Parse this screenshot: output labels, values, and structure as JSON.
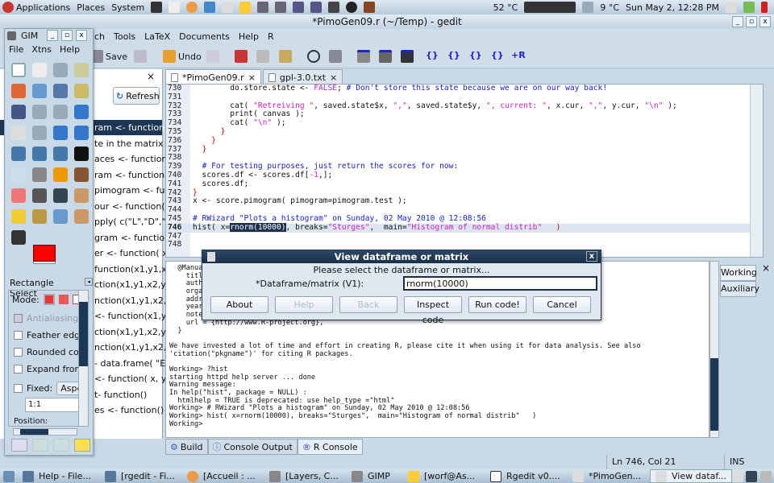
{
  "top_panel": {
    "menus": [
      "Applications",
      "Places",
      "System"
    ],
    "temperature": "52 °C",
    "weather": "9 °C",
    "clock": "Sun May  2, 12:28 PM"
  },
  "window": {
    "title": "*PimoGen09.r (~/Temp) - gedit"
  },
  "menu": [
    "ch",
    "Tools",
    "LaTeX",
    "Documents",
    "Help",
    "R"
  ],
  "toolbar": {
    "save": "Save",
    "undo": "Undo"
  },
  "side_panel": {
    "refresh": "Refresh",
    "items": [
      "ram <- function(",
      "te in the matrix a",
      "aces <- function(",
      "ram <- function(",
      "pimogram <- func",
      "our <- function( x",
      "pply( c(\"L\",\"D\",\"R\",",
      "gram <- function",
      "er <- function( x.p",
      "function(x1,y1,x2",
      "ction(x1,y1,x2,y2)",
      "nction(x1,y1,x2,y",
      "<- function(x1,y1,",
      "ction(x1,y1,x2,y2)",
      "nction(x1,y1,x2,y2",
      "- data.frame( \"Ec",
      "<- function( x, y )",
      "t- function()",
      "es <- function(){"
    ]
  },
  "tabs": [
    {
      "label": "*PimoGen09.r"
    },
    {
      "label": "gpl-3.0.txt"
    }
  ],
  "editor": {
    "lines": [
      {
        "n": "730",
        "html": "        do.store.state <- <span class='kw'>FALSE</span>; <span class='cm'># Don't store this state because we are on our way back!</span>"
      },
      {
        "n": "731",
        "html": ""
      },
      {
        "n": "732",
        "html": "        cat( <span class='str'>\"Retreiving \"</span>, saved.state$x, <span class='str'>\",\"</span>, saved.state$y, <span class='str'>\", current: \"</span>, x.cur, <span class='str'>\",\"</span>, y.cur, <span class='str'>\"\\n\"</span> );"
      },
      {
        "n": "733",
        "html": "        print( canvas );"
      },
      {
        "n": "734",
        "html": "        cat( <span class='str'>\"\\n\"</span> );"
      },
      {
        "n": "735",
        "html": "      <span class='br'>}</span>"
      },
      {
        "n": "736",
        "html": "    <span class='br'>}</span>"
      },
      {
        "n": "737",
        "html": "  <span class='br'>}</span>"
      },
      {
        "n": "738",
        "html": ""
      },
      {
        "n": "739",
        "html": "  <span class='cm'># For testing purposes, just return the scores for now:</span>"
      },
      {
        "n": "740",
        "html": "  scores.df <- scores.df[<span class='str'>-1</span>,];"
      },
      {
        "n": "741",
        "html": "  scores.df;"
      },
      {
        "n": "742",
        "html": "<span class='br'>}</span>"
      },
      {
        "n": "743",
        "html": "x <- score.pimogram( pimogram=pimogram.test );"
      },
      {
        "n": "744",
        "html": ""
      },
      {
        "n": "745",
        "html": "<span class='cm'># RWizard \"Plots a histogram\" on Sunday, 02 May 2010 @ 12:08:56</span>"
      },
      {
        "n": "746",
        "html": "hist( x=<span class='sel'>rnorm(10000)</span>, breaks=<span class='str'>\"Sturges\"</span>,  main=<span class='str'>\"Histogram of normal distrib\"</span>   <span class='br'>)</span>",
        "current": true
      },
      {
        "n": "747",
        "html": ""
      },
      {
        "n": "748",
        "html": ""
      }
    ]
  },
  "console": {
    "lines": [
      "  @Manual{",
      "    title",
      "    author",
      "    organ",
      "    addre",
      "    year =",
      "    note =",
      "    url = {http://www.R-project.org},",
      "  }",
      "",
      "We have invested a lot of time and effort in creating R, please cite it when using it for data analysis. See also",
      "'citation(\"pkgname\")' for citing R packages.",
      "",
      "Working> ?hist",
      "starting httpd help server ... done",
      "Warning message:",
      "In help(\"hist\", package = NULL) :",
      "  htmlhelp = TRUE is deprecated: use help_type =\"html\"",
      "Working> # RWizard \"Plots a histogram\" on Sunday, 02 May 2010 @ 12:08:56",
      "Working> hist( x=rnorm(10000), breaks=\"Sturges\",  main=\"Histogram of normal distrib\"   )",
      "Working>"
    ]
  },
  "side_tabs": [
    "Working",
    "Auxiliary"
  ],
  "bottom_tabs": [
    "Build",
    "Console Output",
    "R Console"
  ],
  "status": {
    "position": "Ln 746, Col 21",
    "mode": "INS"
  },
  "dialog": {
    "title": "View dataframe or matrix",
    "prompt": "Please select the dataframe or matrix...",
    "field_label": "*Dataframe/matrix (V1):",
    "field_value": "rnorm(10000)",
    "buttons": [
      "About",
      "Help",
      "Back",
      "Inspect code",
      "Run code!",
      "Cancel"
    ]
  },
  "gimp": {
    "title": "GIM",
    "menus": [
      "File",
      "Xtns",
      "Help"
    ],
    "tool_options_title": "Rectangle Select",
    "mode_label": "Mode:",
    "options": [
      "Antialiasing",
      "Feather edges",
      "Rounded corn",
      "Expand from c",
      "Fixed:"
    ],
    "fixed_select": "Aspect",
    "ratio": "1:1",
    "position_label": "Position:",
    "fg_color": "#ff0000",
    "bg_color": "#ffffff"
  },
  "taskbar": [
    "Help - File...",
    "[rgedit - Fi...",
    "[Accueil : ...",
    "[Layers, C...",
    "GIMP",
    "[worf@As...",
    "Rgedit v0....",
    "*PimoGen...",
    "View dataf..."
  ]
}
